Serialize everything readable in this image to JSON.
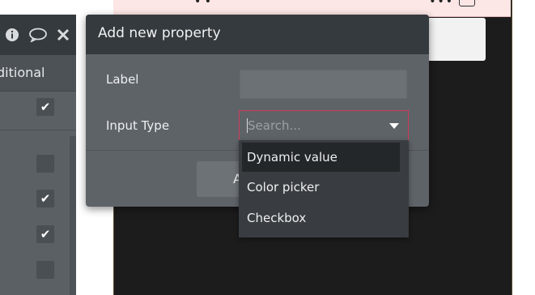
{
  "left_panel": {
    "icons": [
      "info-icon",
      "comment-icon",
      "close-icon"
    ],
    "condition_label": "ditional",
    "checkboxes": [
      {
        "checked": true
      },
      {
        "checked": false
      },
      {
        "checked": true
      },
      {
        "checked": true
      },
      {
        "checked": false
      }
    ]
  },
  "modal": {
    "title": "Add new property",
    "label_field": {
      "label": "Label",
      "value": ""
    },
    "input_type_field": {
      "label": "Input Type",
      "placeholder": "Search...",
      "value": ""
    },
    "add_button_label": "A"
  },
  "dropdown": {
    "items": [
      {
        "label": "Dynamic value",
        "highlighted": true
      },
      {
        "label": "Color picker",
        "highlighted": false
      },
      {
        "label": "Checkbox",
        "highlighted": false
      }
    ]
  },
  "colors": {
    "accent_border": "#d2395d",
    "canvas_header": "#fde6e6",
    "modal_header": "#353a3e"
  }
}
